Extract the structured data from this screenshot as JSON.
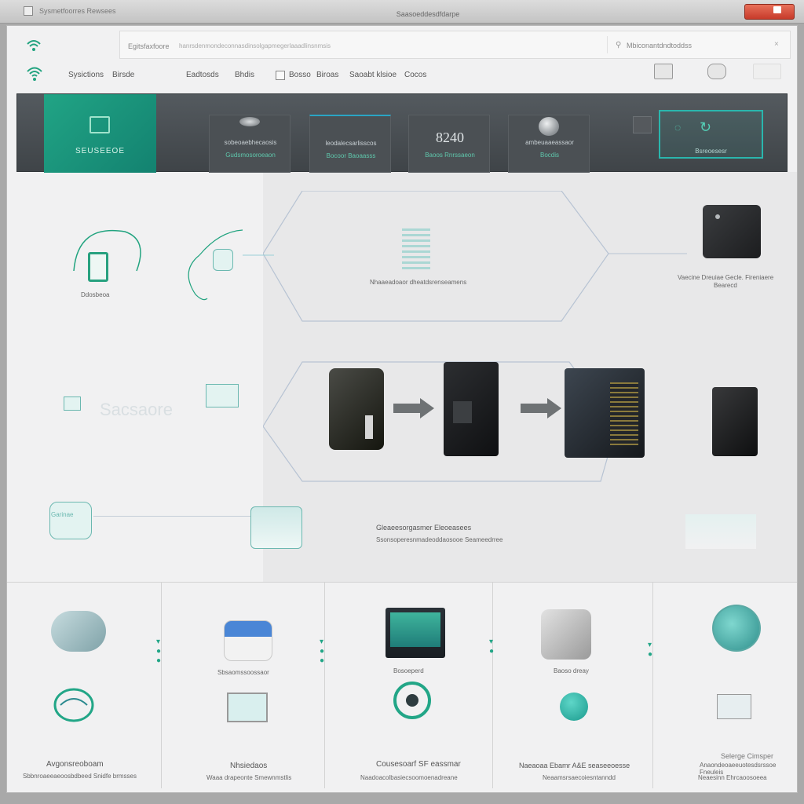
{
  "titlebar": {
    "left_text": "Sysmetfoorres Rewsees",
    "title": "Saasoeddesdfdarpe"
  },
  "toolbar": {
    "address": "Egitsfaxfoore",
    "address_detail": "hanrsdenmondeconnasdinsolgapmegerlaaadlinsnmsis",
    "search_placeholder": "Mbiconantdndtoddss"
  },
  "nav": {
    "items": [
      "Sysictions",
      "Birsde",
      "Eadtosds",
      "Bhdis",
      "Bosso",
      "Biroas",
      "Saoabt klsioe",
      "Cocos"
    ]
  },
  "dashboard": {
    "primary_label": "SEUSEEOE",
    "cards": [
      {
        "top": "sobeoaebhecaosis",
        "bottom": "Gudsmosoroeaon"
      },
      {
        "top": "leodalecsarlisscos",
        "bottom": "Bocoor Baoaasss"
      },
      {
        "big": "8240",
        "bottom": "Baoos Rnrssaeon"
      },
      {
        "top": "ambeuaaeassaor",
        "bottom": "Bocdis"
      },
      {
        "bottom": "Bsreoesesr"
      }
    ]
  },
  "diagram": {
    "phone_label": "Ddosbeoa",
    "hex_label": "Nhaaeadoaor dheatdsrenseamens",
    "server_label_1": "Vaecine Dreuiae Gecle. Fireniaere",
    "server_label_2": "Bearecd",
    "watermark": "Sacsaore",
    "flow_label_1": "Gleaeesorgasmer Eleoeasees",
    "flow_label_2": "Ssonsoperesnmadeoddaosooe Seameedrree",
    "left_label": "Garinae"
  },
  "bottom": {
    "columns": [
      {
        "mid": "",
        "title": "Avgonsreoboam",
        "sub": "Sbbnroaeeaeoosbdbeed Snidfe brmsses"
      },
      {
        "mid": "Sbsaomssoossaor",
        "title": "Nhsiedaos",
        "sub": "Waaa drapeonte Smewnmstlis"
      },
      {
        "mid": "Bosoeperd",
        "title": "Cousesoarf SF eassmar",
        "sub": "Naadoacolbasiecsoomoenadreane"
      },
      {
        "mid": "Baoso dreay",
        "title": "Naeaoaa Ebamr A&E seaseeoesse",
        "sub": "Neaamsrsaecoiesntanndd"
      },
      {
        "mid": "",
        "title": "Anaondeoaeeuotesdsrssoe Fneuleis",
        "sub": "Neaesinn Ehrcaoosoeea"
      }
    ]
  },
  "footer": {
    "text": "Selerge Cimsper"
  },
  "colors": {
    "accent": "#21a485",
    "dashboard_bg": "#4a4f53",
    "close_button": "#d4503c"
  }
}
